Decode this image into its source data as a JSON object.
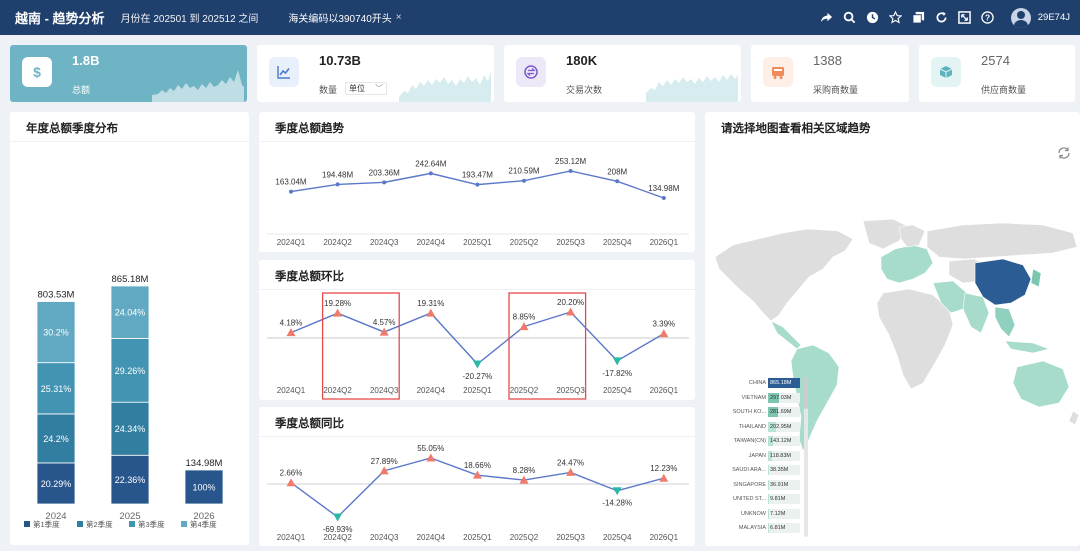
{
  "header": {
    "title": "越南 - 趋势分析",
    "filter_month": "月份在 202501 到 202512 之间",
    "filter_hs": "海关编码以390740开头",
    "user": "29E74J"
  },
  "kpis": [
    {
      "value": "1.8B",
      "label": "总额",
      "icon": "dollar-icon",
      "active": true
    },
    {
      "value": "10.73B",
      "label": "数量",
      "unit": "单位",
      "icon": "line-chart-icon"
    },
    {
      "value": "180K",
      "label": "交易次数",
      "icon": "exchange-icon"
    },
    {
      "value": "1388",
      "label": "采购商数量",
      "icon": "buyer-icon"
    },
    {
      "value": "2574",
      "label": "供应商数量",
      "icon": "box-icon"
    }
  ],
  "colors": {
    "header": "#1f3f6d",
    "accent": "#6fb4c4",
    "line": "#5b78c9",
    "up": "#f07b6a",
    "down": "#2bb8a6",
    "highlight": "#e44b4b"
  },
  "panels": {
    "annual": {
      "title": "年度总额季度分布"
    },
    "trend": {
      "title": "季度总额趋势"
    },
    "qoq": {
      "title": "季度总额环比"
    },
    "yoy": {
      "title": "季度总额同比"
    },
    "map": {
      "title": "请选择地图查看相关区域趋势"
    }
  },
  "chart_data": [
    {
      "id": "annual",
      "type": "bar",
      "stacked": true,
      "categories": [
        "2024",
        "2025",
        "2026"
      ],
      "totals": [
        "803.53M",
        "865.18M",
        "134.98M"
      ],
      "series": [
        {
          "name": "第1季度",
          "values": [
            20.29,
            22.36,
            100
          ],
          "labels": [
            "20.29%",
            "22.36%",
            "100%"
          ],
          "color": "#27558c"
        },
        {
          "name": "第2季度",
          "values": [
            24.2,
            24.34,
            0
          ],
          "labels": [
            "24.2%",
            "24.34%",
            ""
          ],
          "color": "#327ea1"
        },
        {
          "name": "第3季度",
          "values": [
            25.31,
            29.26,
            0
          ],
          "labels": [
            "25.31%",
            "29.26%",
            ""
          ],
          "color": "#4393b2"
        },
        {
          "name": "第4季度",
          "values": [
            30.2,
            24.04,
            0
          ],
          "labels": [
            "30.2%",
            "24.04%",
            ""
          ],
          "color": "#61a9c2"
        }
      ],
      "legend": "bottom"
    },
    {
      "id": "trend",
      "type": "line",
      "categories": [
        "2024Q1",
        "2024Q2",
        "2024Q3",
        "2024Q4",
        "2025Q1",
        "2025Q2",
        "2025Q3",
        "2025Q4",
        "2026Q1"
      ],
      "values": [
        163.04,
        194.48,
        203.36,
        242.64,
        193.47,
        210.59,
        253.12,
        208,
        134.98
      ],
      "labels": [
        "163.04M",
        "194.48M",
        "203.36M",
        "242.64M",
        "193.47M",
        "210.59M",
        "253.12M",
        "208M",
        "134.98M"
      ]
    },
    {
      "id": "qoq",
      "type": "line",
      "categories": [
        "2024Q1",
        "2024Q2",
        "2024Q3",
        "2024Q4",
        "2025Q1",
        "2025Q2",
        "2025Q3",
        "2025Q4",
        "2026Q1"
      ],
      "values": [
        4.18,
        19.28,
        4.57,
        19.31,
        -20.27,
        8.85,
        20.2,
        -17.82,
        3.39
      ],
      "labels": [
        "4.18%",
        "19.28%",
        "4.57%",
        "19.31%",
        "-20.27%",
        "8.85%",
        "20.20%",
        "-17.82%",
        "3.39%"
      ],
      "highlight_groups": [
        [
          "2024Q2",
          "2024Q3"
        ],
        [
          "2025Q2",
          "2025Q3"
        ]
      ]
    },
    {
      "id": "yoy",
      "type": "line",
      "categories": [
        "2024Q1",
        "2024Q2",
        "2024Q3",
        "2024Q4",
        "2025Q1",
        "2025Q2",
        "2025Q3",
        "2025Q4",
        "2026Q1"
      ],
      "values": [
        2.66,
        -69.93,
        27.89,
        55.05,
        18.66,
        8.28,
        24.47,
        -14.28,
        12.23
      ],
      "labels": [
        "2.66%",
        "-69.93%",
        "27.89%",
        "55.05%",
        "18.66%",
        "8.28%",
        "24.47%",
        "-14.28%",
        "12.23%"
      ]
    },
    {
      "id": "map-ranking",
      "type": "bar",
      "orientation": "horizontal",
      "categories": [
        "CHINA",
        "VIETNAM",
        "SOUTH KO...",
        "THAILAND",
        "TAIWAN(CN)",
        "JAPAN",
        "SAUDI ARA...",
        "SINGAPORE",
        "UNITED ST...",
        "UNKNOW",
        "MALAYSIA"
      ],
      "values": [
        865.18,
        297.03,
        281.69,
        202.95,
        143.12,
        118.83,
        38.35,
        36.91,
        9.81,
        7.12,
        6.81
      ],
      "labels": [
        "865.18M",
        "297.03M",
        "281.69M",
        "202.95M",
        "143.12M",
        "118.83M",
        "38.35M",
        "36.91M",
        "9.81M",
        "7.12M",
        "6.81M"
      ]
    }
  ]
}
